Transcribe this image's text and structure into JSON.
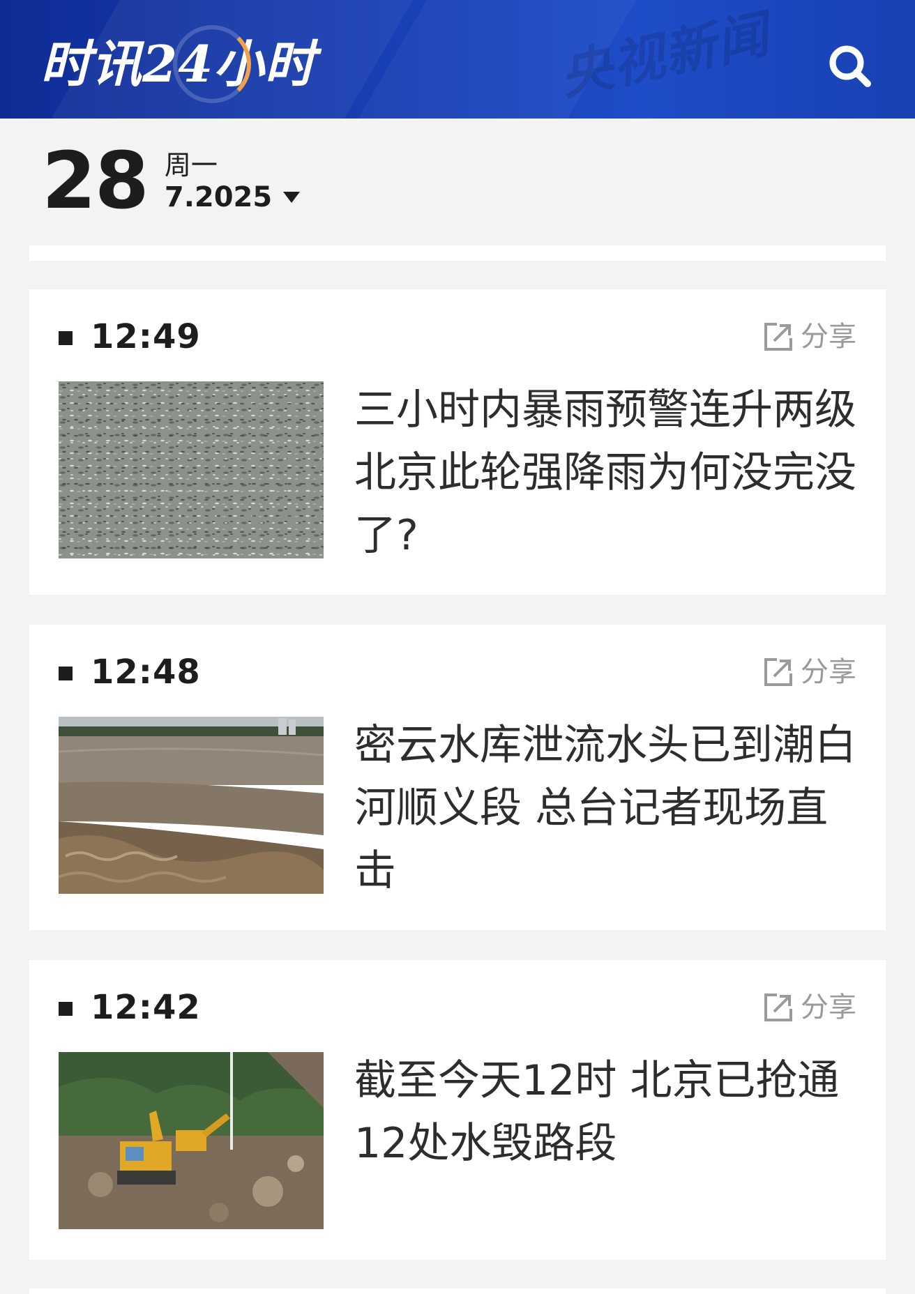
{
  "header": {
    "brand": "时讯24小时",
    "watermark": "央视新闻",
    "icon": "search-icon",
    "colors": {
      "bg": "#1a40b6",
      "accent": "#f0a14a"
    }
  },
  "date": {
    "day": "28",
    "weekday": "周一",
    "month_year": "7.2025",
    "icon": "caret-down-icon"
  },
  "news": [
    {
      "time": "12:49",
      "share_label": "分享",
      "title": "三小时内暴雨预警连升两级 北京此轮强降雨为何没完没了?",
      "image": "rain-on-water"
    },
    {
      "time": "12:48",
      "share_label": "分享",
      "title": "密云水库泄流水头已到潮白河顺义段 总台记者现场直击",
      "image": "flood-river"
    },
    {
      "time": "12:42",
      "share_label": "分享",
      "title": "截至今天12时 北京已抢通12处水毁路段",
      "image": "excavator-repair"
    }
  ]
}
